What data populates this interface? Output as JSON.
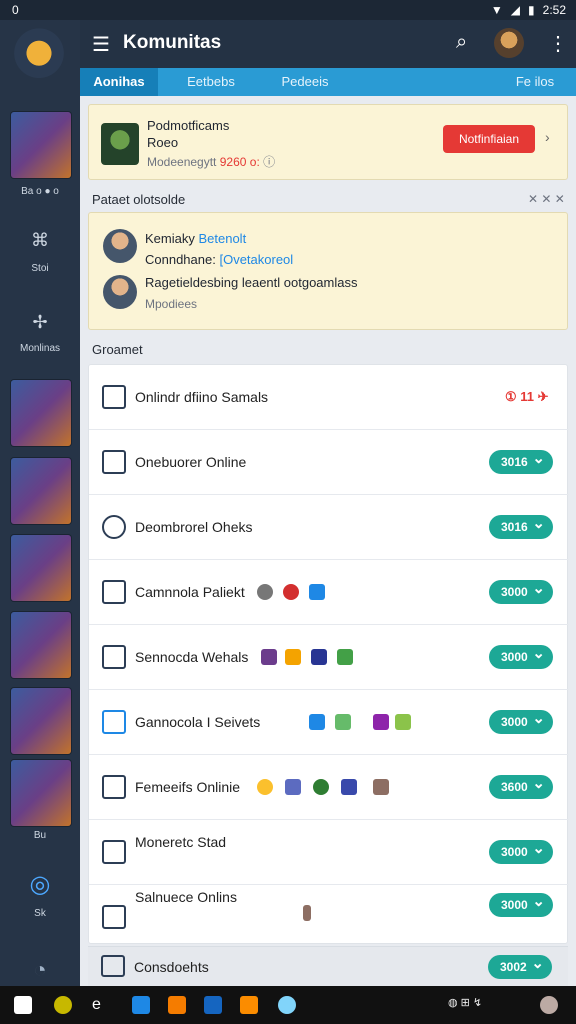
{
  "status": {
    "left": "0",
    "time": "2:52",
    "icons": [
      "wifi-icon",
      "signal-icon",
      "battery-icon"
    ]
  },
  "rail": {
    "nav": [
      {
        "label": "Ba o ● o",
        "icon": "game-icon"
      },
      {
        "label": "Stoi",
        "icon": "store-icon"
      },
      {
        "label": "Monlinas",
        "icon": "community-icon"
      },
      {
        "label": "Bu",
        "icon": "library-icon"
      },
      {
        "label": "Sk",
        "icon": "refresh-icon"
      }
    ]
  },
  "appbar": {
    "title": "Komunitas",
    "menu_icon": "menu-icon",
    "search_icon": "search-icon",
    "more_icon": "more-icon"
  },
  "tabs": [
    "Aonihas",
    "Eetbebs",
    "Pedeeis",
    "Fe ilos"
  ],
  "promo": {
    "title": "Podmotficams",
    "subtitle": "Roeo",
    "meta_prefix": "Modeenegytt",
    "meta_highlight": "9260 o:",
    "button": "Notfinfiaian"
  },
  "section1": {
    "title": "Pataet olotsolde",
    "side": "✕ ✕ ✕"
  },
  "notify": {
    "line1_name": "Kemiaky",
    "line1_link": "Betenolt",
    "line2_prefix": "Conndhane:",
    "line2_link": "[Ovetakoreol",
    "line3": "Ragetieldesbing leaentl ootgoamlass",
    "line4": "Mpodiees"
  },
  "section2": {
    "title": "Groamet"
  },
  "rows": [
    {
      "label": "Onlindr dfiino Samals",
      "pill": "",
      "badge": "① 11 ✈"
    },
    {
      "label": "Onebuorer Online",
      "pill": "3016"
    },
    {
      "label": "Deombrorel Oheks",
      "pill": "3016"
    },
    {
      "label": "Camnnola Paliekt",
      "pill": "3000"
    },
    {
      "label": "Sennocda Wehals",
      "pill": "3000"
    },
    {
      "label": "Gannocola I Seivets",
      "pill": "3000"
    },
    {
      "label": "Femeeifs Onlinie",
      "pill": "3600"
    },
    {
      "label": "Moneretc Stad",
      "pill": "3000"
    },
    {
      "label": "Salnuece Onlins",
      "pill": "3000"
    }
  ],
  "footer": {
    "label": "Consdoehts",
    "pill": "3002"
  },
  "colors": {
    "accent": "#2a9bd4",
    "teal": "#1da896",
    "red": "#e53935",
    "dark": "#243244"
  }
}
